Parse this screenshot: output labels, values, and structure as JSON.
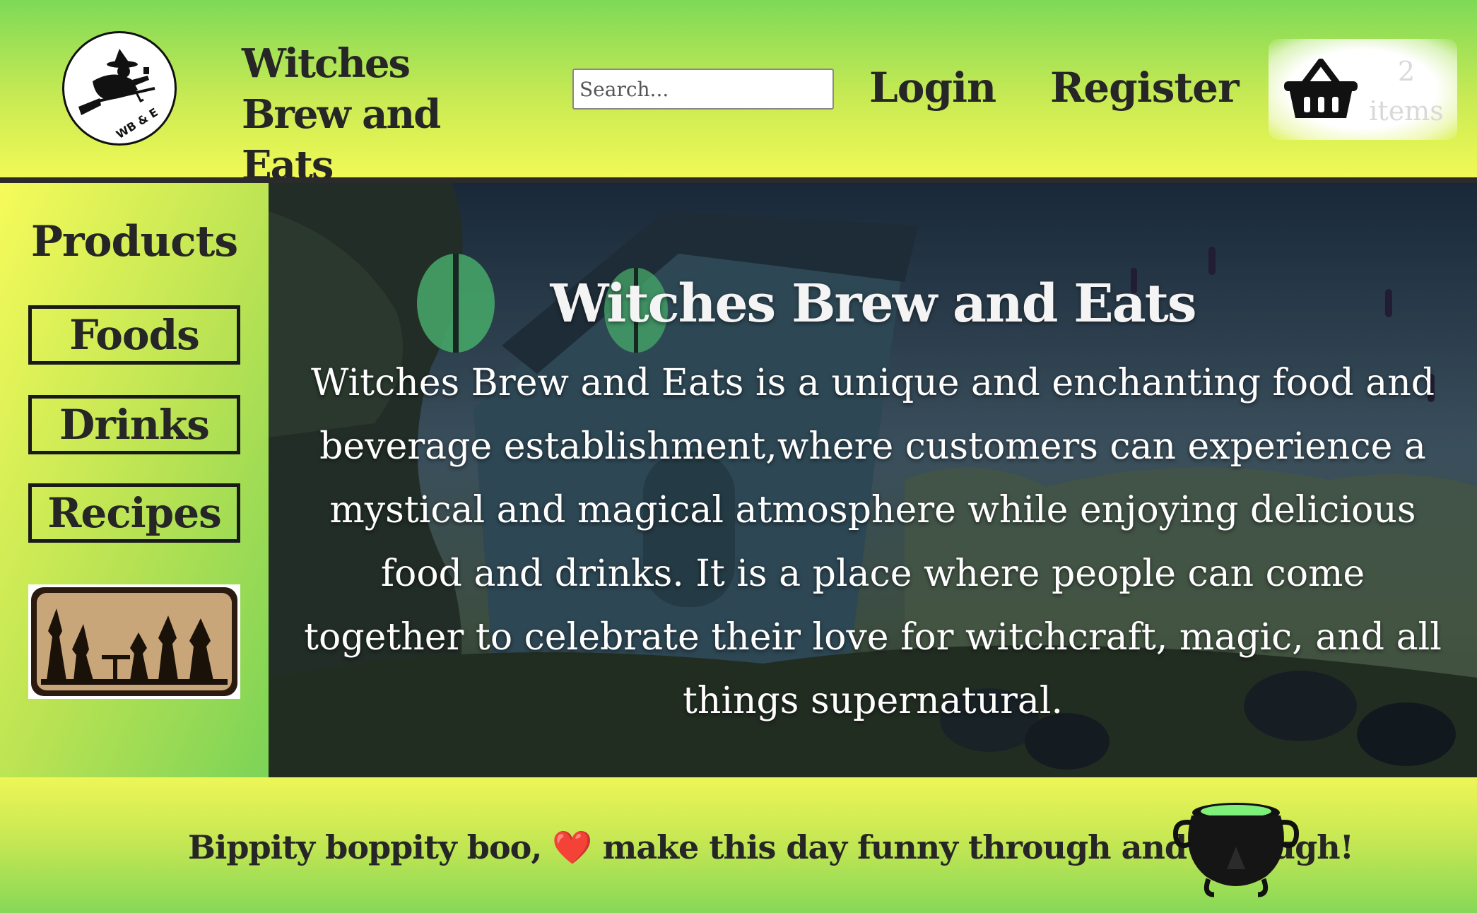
{
  "header": {
    "logo_text": "WB & E",
    "site_title": "Witches Brew and Eats",
    "search_placeholder": "Search...",
    "nav": {
      "login": "Login",
      "register": "Register"
    },
    "cart": {
      "count": "2",
      "unit": "items",
      "icon": "basket-icon"
    }
  },
  "sidebar": {
    "title": "Products",
    "items": [
      {
        "label": "Foods"
      },
      {
        "label": "Drinks"
      },
      {
        "label": "Recipes"
      }
    ],
    "image": "witches-tea-party-silhouette"
  },
  "hero": {
    "title": "Witches Brew and Eats",
    "text": "Witches Brew and Eats is a unique and enchanting food and beverage establishment,where customers can experience a mystical and magical atmosphere while enjoying delicious food and drinks. It is a place where people can come together to celebrate their love for witchcraft, magic, and all things supernatural."
  },
  "footer": {
    "text_before": "Bippity boppity boo, ",
    "heart": "❤️",
    "text_after": " make this day funny through and through!",
    "icon": "cauldron-icon"
  },
  "colors": {
    "header_top": "#7ed957",
    "header_bottom": "#f1f955",
    "text": "#262626",
    "divider": "#2b2b2b"
  }
}
